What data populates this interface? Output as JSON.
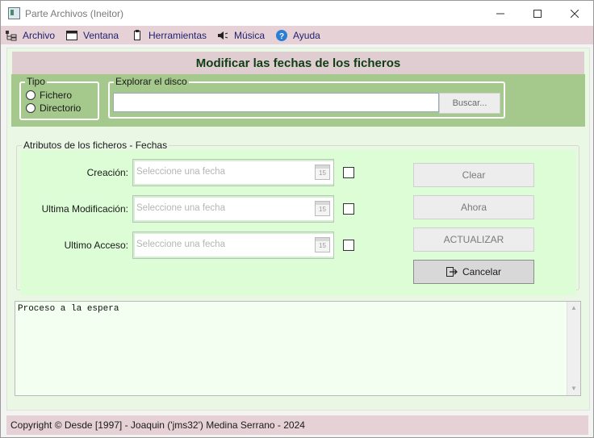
{
  "window": {
    "title": "Parte Archivos (Ineitor)",
    "minimize_icon": "minimize-icon",
    "maximize_icon": "maximize-icon",
    "close_icon": "close-icon"
  },
  "menu": {
    "items": [
      {
        "label": "Archivo",
        "icon": "file-tree-icon"
      },
      {
        "label": "Ventana",
        "icon": "window-icon"
      },
      {
        "label": "Herramientas",
        "icon": "tools-icon"
      },
      {
        "label": "Música",
        "icon": "speaker-icon"
      },
      {
        "label": "Ayuda",
        "icon": "help-icon"
      }
    ]
  },
  "header": {
    "title": "Modificar las fechas de los ficheros"
  },
  "tipo": {
    "legend": "Tipo",
    "options": [
      "Fichero",
      "Directorio"
    ]
  },
  "explorar": {
    "legend": "Explorar el disco",
    "path_value": "",
    "button_label": "Buscar..."
  },
  "atributos": {
    "legend": "Atributos de los ficheros - Fechas",
    "rows": [
      {
        "label": "Creación:",
        "placeholder": "Seleccione una fecha",
        "calendar_day": "15"
      },
      {
        "label": "Ultima Modificación:",
        "placeholder": "Seleccione una fecha",
        "calendar_day": "15"
      },
      {
        "label": "Ultimo Acceso:",
        "placeholder": "Seleccione una fecha",
        "calendar_day": "15"
      }
    ]
  },
  "actions": {
    "clear": "Clear",
    "ahora": "Ahora",
    "actualizar": "ACTUALIZAR",
    "cancelar": "Cancelar",
    "cancelar_icon": "exit-icon"
  },
  "log": {
    "text": "Proceso a la espera"
  },
  "status": {
    "text": "Copyright © Desde [1997] - Joaquin ('jms32') Medina Serrano - 2024"
  },
  "colors": {
    "menubar": "#e6d2d6",
    "header_band": "#e0cdd2",
    "green_band": "#a5c88c",
    "panel": "#eaf7e4",
    "attributes_area": "#dcfdd5",
    "title_text": "#0e3e12"
  }
}
